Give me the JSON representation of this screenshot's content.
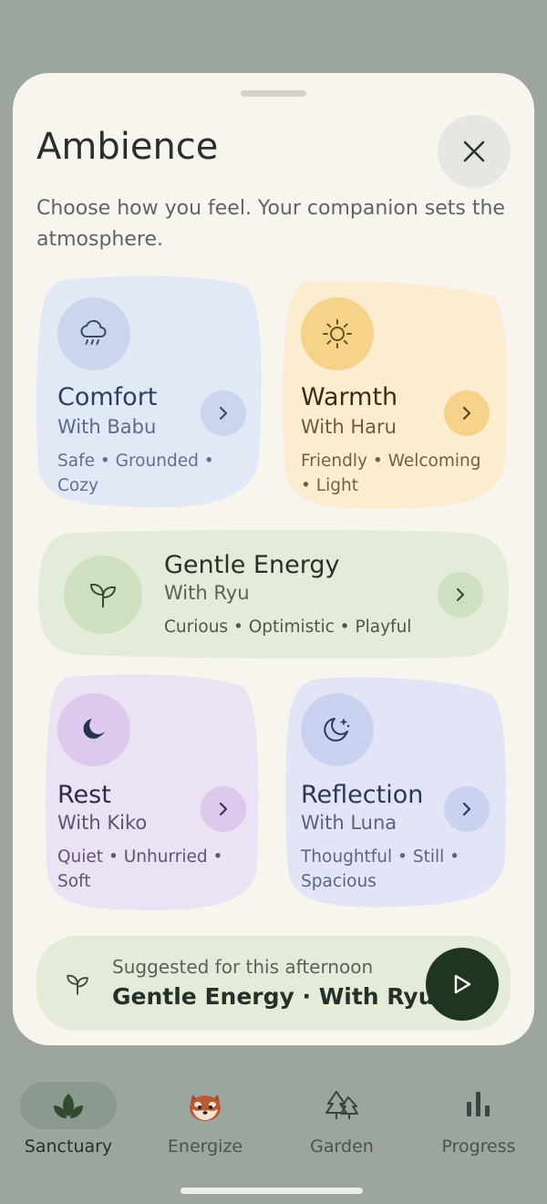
{
  "sheet": {
    "title": "Ambience",
    "subtitle": "Choose how you feel. Your companion sets the atmosphere."
  },
  "cards": [
    {
      "name": "Comfort",
      "with": "With Babu",
      "tags": "Safe • Grounded • Cozy",
      "icon": "rain-cloud-icon",
      "color": "#e2e9f6"
    },
    {
      "name": "Warmth",
      "with": "With Haru",
      "tags": "Friendly • Welcoming • Light",
      "icon": "sun-icon",
      "color": "#fcecd0"
    },
    {
      "name": "Gentle Energy",
      "with": "With Ryu",
      "tags": "Curious • Optimistic • Playful",
      "icon": "sprout-icon",
      "color": "#e3ebd9"
    },
    {
      "name": "Rest",
      "with": "With Kiko",
      "tags": "Quiet • Unhurried • Soft",
      "icon": "moon-icon",
      "color": "#ebe2f3"
    },
    {
      "name": "Reflection",
      "with": "With Luna",
      "tags": "Thoughtful • Still • Spacious",
      "icon": "moon-stars-icon",
      "color": "#e1e5f6"
    }
  ],
  "suggestion": {
    "label": "Suggested for this afternoon",
    "value": "Gentle Energy · With Ryu",
    "icon": "sprout-icon",
    "play_icon": "play-icon"
  },
  "tabs": [
    {
      "label": "Sanctuary",
      "icon": "leaves-icon",
      "active": true
    },
    {
      "label": "Energize",
      "icon": "red-panda-icon",
      "active": false
    },
    {
      "label": "Garden",
      "icon": "trees-icon",
      "active": false
    },
    {
      "label": "Progress",
      "icon": "bar-chart-icon",
      "active": false
    }
  ]
}
